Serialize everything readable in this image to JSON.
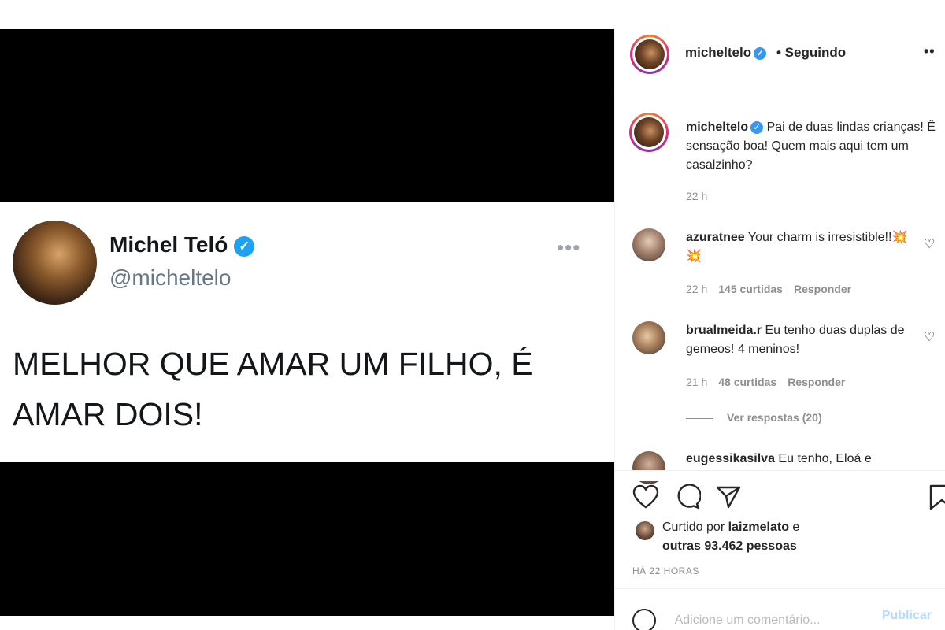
{
  "tweet": {
    "name": "Michel Teló",
    "handle": "@micheltelo",
    "more": "•••",
    "text": "MELHOR QUE AMAR UM FILHO, É AMAR DOIS!"
  },
  "post_header": {
    "username": "micheltelo",
    "follow_status": "• Seguindo",
    "more": "••"
  },
  "caption": {
    "username": "micheltelo",
    "text": "Pai de duas lindas crianças! Ê sensação boa! Quem mais aqui tem um casalzinho?",
    "time": "22 h"
  },
  "comments": [
    {
      "username": "azuratnee",
      "text": "Your charm is irresistible!!💥💥",
      "time": "22 h",
      "likes": "145 curtidas",
      "reply": "Responder"
    },
    {
      "username": "brualmeida.r",
      "text": "Eu tenho duas duplas de gemeos! 4 meninos!",
      "time": "21 h",
      "likes": "48 curtidas",
      "reply": "Responder",
      "view_replies": "Ver respostas (20)"
    },
    {
      "username": "eugessikasilva",
      "text": "Eu tenho, Eloá e"
    }
  ],
  "likes": {
    "prefix": "Curtido por",
    "user": "laizmelato",
    "connector": "e",
    "others": "outras 93.462 pessoas"
  },
  "timestamp": "HÁ 22 HORAS",
  "add_comment": {
    "placeholder": "Adicione um comentário...",
    "publish": "Publicar"
  },
  "colors": {
    "verified_twitter": "#1da1f2",
    "verified_instagram": "#3897f0",
    "muted": "#8e8e8e"
  }
}
